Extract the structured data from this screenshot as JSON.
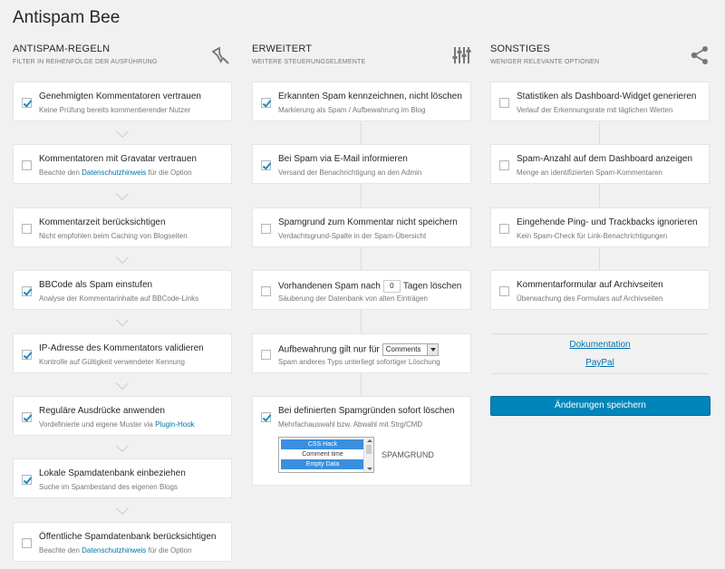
{
  "app": {
    "title": "Antispam Bee"
  },
  "columns": [
    {
      "title": "ANTISPAM-REGELN",
      "subtitle": "FILTER IN REIHENFOLGE DER AUSFÜHRUNG",
      "icon": "funnel-icon",
      "options": [
        {
          "label": "Genehmigten Kommentatoren vertrauen",
          "desc": "Keine Prüfung bereits kommentierender Nutzer",
          "checked": true
        },
        {
          "label": "Kommentatoren mit Gravatar vertrauen",
          "desc_pre": "Beachte den ",
          "desc_link": "Datenschutzhinweis",
          "desc_post": " für die Option",
          "checked": false
        },
        {
          "label": "Kommentarzeit berücksichtigen",
          "desc": "Nicht empfohlen beim Caching von Blogseiten",
          "checked": false
        },
        {
          "label": "BBCode als Spam einstufen",
          "desc": "Analyse der Kommentarinhalte auf BBCode-Links",
          "checked": true
        },
        {
          "label": "IP-Adresse des Kommentators validieren",
          "desc": "Kontrolle auf Gültigkeit verwendeter Kennung",
          "checked": true
        },
        {
          "label": "Reguläre Ausdrücke anwenden",
          "desc_pre": "Vordefinierte und eigene Muster via ",
          "desc_link": "Plugin-Hook",
          "desc_post": "",
          "checked": true
        },
        {
          "label": "Lokale Spamdatenbank einbeziehen",
          "desc": "Suche im Spambestand des eigenen Blogs",
          "checked": true
        },
        {
          "label": "Öffentliche Spamdatenbank berücksichtigen",
          "desc_pre": "Beachte den ",
          "desc_link": "Datenschutzhinweis",
          "desc_post": " für die Option",
          "checked": false
        }
      ]
    },
    {
      "title": "ERWEITERT",
      "subtitle": "WEITERE STEUERUNGSELEMENTE",
      "icon": "sliders-icon",
      "options": [
        {
          "label": "Erkannten Spam kennzeichnen, nicht löschen",
          "desc": "Markierung als Spam / Aufbewahrung im Blog",
          "checked": true
        },
        {
          "label": "Bei Spam via E-Mail informieren",
          "desc": "Versand der Benachrichtigung an den Admin",
          "checked": true
        },
        {
          "label": "Spamgrund zum Kommentar nicht speichern",
          "desc": "Verdachtsgrund-Spalte in der Spam-Übersicht",
          "checked": false
        },
        {
          "label_pre": "Vorhandenen Spam nach",
          "days_value": "0",
          "label_post": "Tagen löschen",
          "desc": "Säuberung der Datenbank von alten Einträgen",
          "checked": false
        },
        {
          "label_pre": "Aufbewahrung gilt nur für",
          "select_value": "Comments",
          "desc": "Spam anderes Typs unterliegt sofortiger Löschung",
          "checked": false
        },
        {
          "label": "Bei definierten Spamgründen sofort löschen",
          "desc": "Mehrfachauswahl bzw. Abwahl mit Strg/CMD",
          "checked": true,
          "reasons": [
            "CSS Hack",
            "Comment time",
            "Empty Data"
          ],
          "reasons_label": "SPAMGRUND"
        }
      ]
    },
    {
      "title": "SONSTIGES",
      "subtitle": "WENIGER RELEVANTE OPTIONEN",
      "icon": "share-icon",
      "options": [
        {
          "label": "Statistiken als Dashboard-Widget generieren",
          "desc": "Verlauf der Erkennungsrate mit täglichen Werten",
          "checked": false
        },
        {
          "label": "Spam-Anzahl auf dem Dashboard anzeigen",
          "desc": "Menge an identifizierten Spam-Kommentaren",
          "checked": false
        },
        {
          "label": "Eingehende Ping- und Trackbacks ignorieren",
          "desc": "Kein Spam-Check für Link-Benachrichtigungen",
          "checked": false
        },
        {
          "label": "Kommentarformular auf Archivseiten",
          "desc": "Überwachung des Formulars auf Archivseiten",
          "checked": false
        }
      ],
      "links": [
        "Dokumentation",
        "PayPal"
      ],
      "save_label": "Änderungen speichern"
    }
  ]
}
